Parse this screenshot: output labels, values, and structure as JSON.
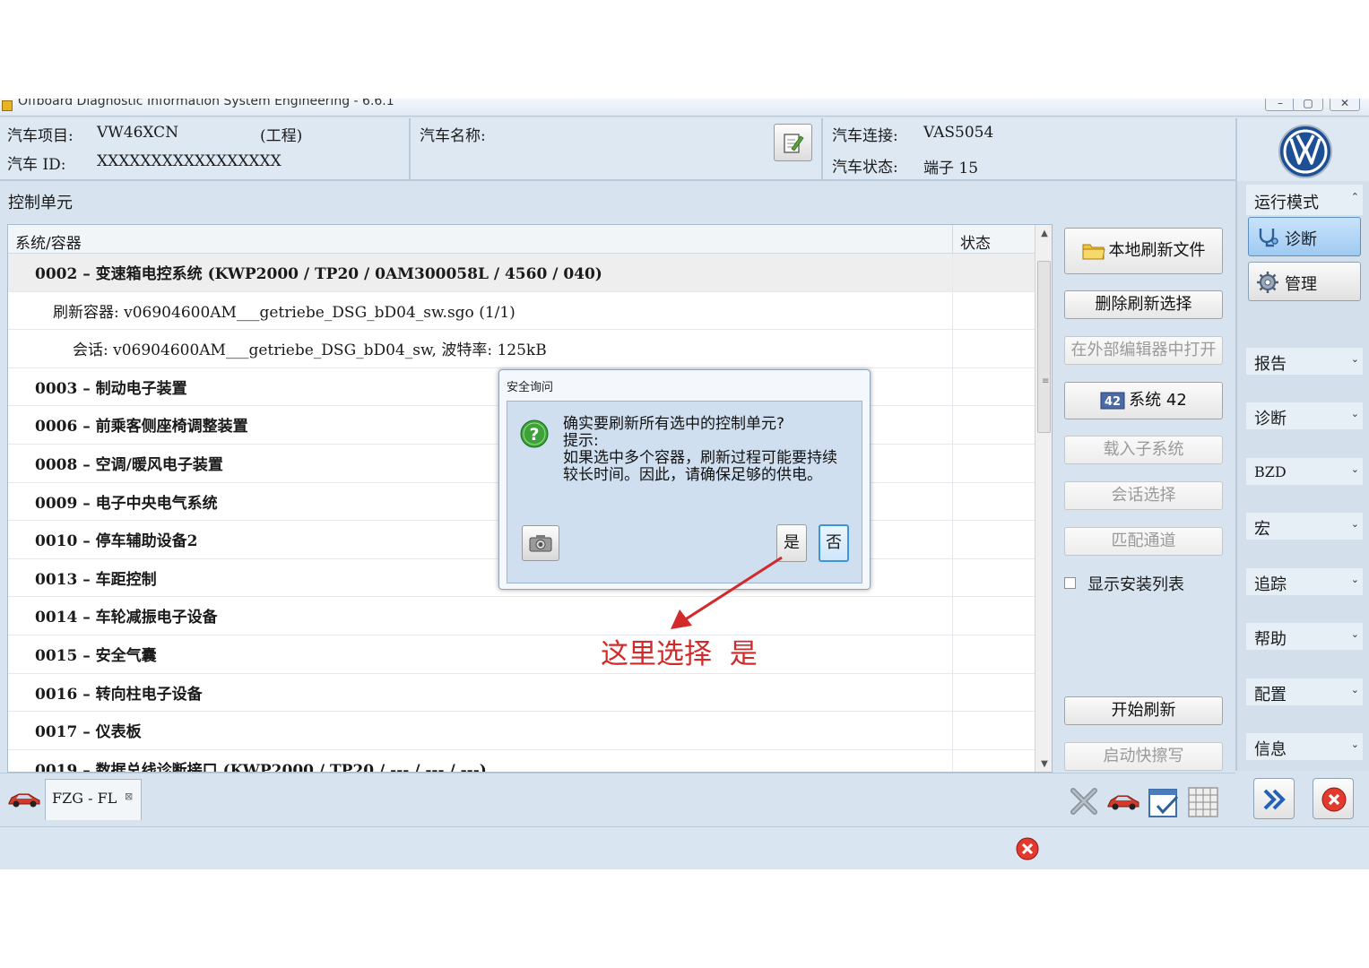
{
  "window": {
    "title": "Offboard Diagnostic Information System Engineering - 6.6.1",
    "controls": [
      "–",
      "▢",
      "✕"
    ]
  },
  "header": {
    "project_label": "汽车项目:",
    "project_value": "VW46XCN",
    "project_mode": "(工程)",
    "id_label": "汽车 ID:",
    "id_value": "XXXXXXXXXXXXXXXXX",
    "name_label": "汽车名称:",
    "connection_label": "汽车连接:",
    "connection_value": "VAS5054",
    "state_label": "汽车状态:",
    "state_value": "端子 15"
  },
  "section_title": "控制单元",
  "table": {
    "col_system": "系统/容器",
    "col_status": "状态",
    "rows": [
      {
        "text": "0002 – 变速箱电控系统  (KWP2000 / TP20 / 0AM300058L / 4560 / 040)",
        "bold": true
      },
      {
        "text": "刷新容器: v06904600AM___getriebe_DSG_bD04_sw.sgo (1/1)",
        "bold": false
      },
      {
        "text": "会话: v06904600AM___getriebe_DSG_bD04_sw, 波特率: 125kB",
        "bold": false
      },
      {
        "text": "0003 – 制动电子装置",
        "bold": true
      },
      {
        "text": "0006 – 前乘客侧座椅调整装置",
        "bold": true
      },
      {
        "text": "0008 – 空调/暖风电子装置",
        "bold": true
      },
      {
        "text": "0009 – 电子中央电气系统",
        "bold": true
      },
      {
        "text": "0010 – 停车辅助设备2",
        "bold": true
      },
      {
        "text": "0013 – 车距控制",
        "bold": true
      },
      {
        "text": "0014 – 车轮减振电子设备",
        "bold": true
      },
      {
        "text": "0015 – 安全气囊",
        "bold": true
      },
      {
        "text": "0016 – 转向柱电子设备",
        "bold": true
      },
      {
        "text": "0017 – 仪表板",
        "bold": true
      },
      {
        "text": "0019 – 数据总线诊断接口  (KWP2000 / TP20 / --- / --- / ---)",
        "bold": true
      }
    ]
  },
  "actions": {
    "local_flash_file": "本地刷新文件",
    "delete_flash_selection": "删除刷新选择",
    "open_external_editor": "在外部编辑器中打开",
    "system_42": "系统 42",
    "load_subsystem": "载入子系统",
    "session_select": "会话选择",
    "adaptation_channel": "匹配通道",
    "show_install_list": "显示安装列表",
    "start_flash": "开始刷新",
    "start_quick_erase": "启动快擦写"
  },
  "sidebar": {
    "mode_header": "运行模式",
    "modes": [
      {
        "label": "诊断",
        "active": true
      },
      {
        "label": "管理",
        "active": false
      }
    ],
    "sections": [
      "报告",
      "诊断",
      "BZD",
      "宏",
      "追踪",
      "帮助",
      "配置",
      "信息"
    ]
  },
  "tab": {
    "label": "FZG - FL"
  },
  "dialog": {
    "title": "安全询问",
    "message_lines": [
      "确实要刷新所有选中的控制单元?",
      "提示:",
      "如果选中多个容器，刷新过程可能要持续",
      "较长时间。因此，请确保足够的供电。"
    ],
    "yes": "是",
    "no": "否"
  },
  "annotation": "这里选择  是",
  "colors": {
    "accent_red": "#d22a2a",
    "window_bg": "#d7e4f0",
    "active_mode": "#9fcaf1"
  }
}
